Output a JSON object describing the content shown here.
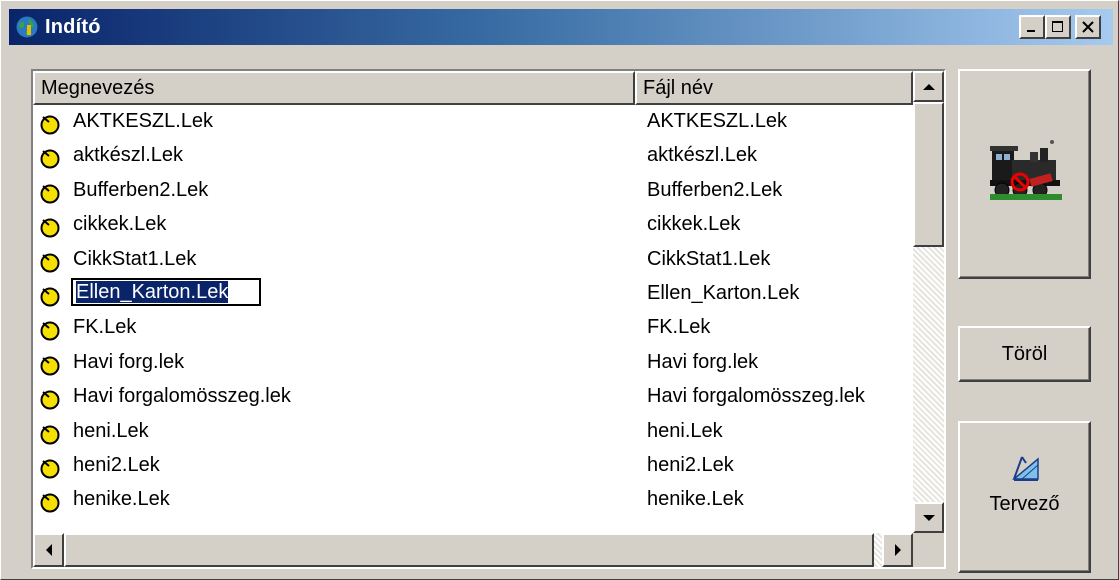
{
  "window": {
    "title": "Indító"
  },
  "list": {
    "columns": [
      "Megnevezés",
      "Fájl név"
    ],
    "items": [
      {
        "name": "AKTKESZL.Lek",
        "file": "AKTKESZL.Lek"
      },
      {
        "name": "aktkészl.Lek",
        "file": "aktkészl.Lek"
      },
      {
        "name": "Bufferben2.Lek",
        "file": "Bufferben2.Lek"
      },
      {
        "name": "cikkek.Lek",
        "file": "cikkek.Lek"
      },
      {
        "name": "CikkStat1.Lek",
        "file": "CikkStat1.Lek"
      },
      {
        "name": "Ellen_Karton.Lek",
        "file": "Ellen_Karton.Lek"
      },
      {
        "name": "FK.Lek",
        "file": "FK.Lek"
      },
      {
        "name": "Havi forg.lek",
        "file": "Havi forg.lek"
      },
      {
        "name": "Havi forgalomösszeg.lek",
        "file": "Havi forgalomösszeg.lek"
      },
      {
        "name": "heni.Lek",
        "file": "heni.Lek"
      },
      {
        "name": "heni2.Lek",
        "file": "heni2.Lek"
      },
      {
        "name": "henike.Lek",
        "file": "henike.Lek"
      }
    ],
    "editing_index": 5
  },
  "buttons": {
    "delete": "Töröl",
    "designer": "Tervező"
  },
  "colors": {
    "selection": "#0a246a",
    "face": "#d4d0c8",
    "icon": "#f5e000"
  }
}
